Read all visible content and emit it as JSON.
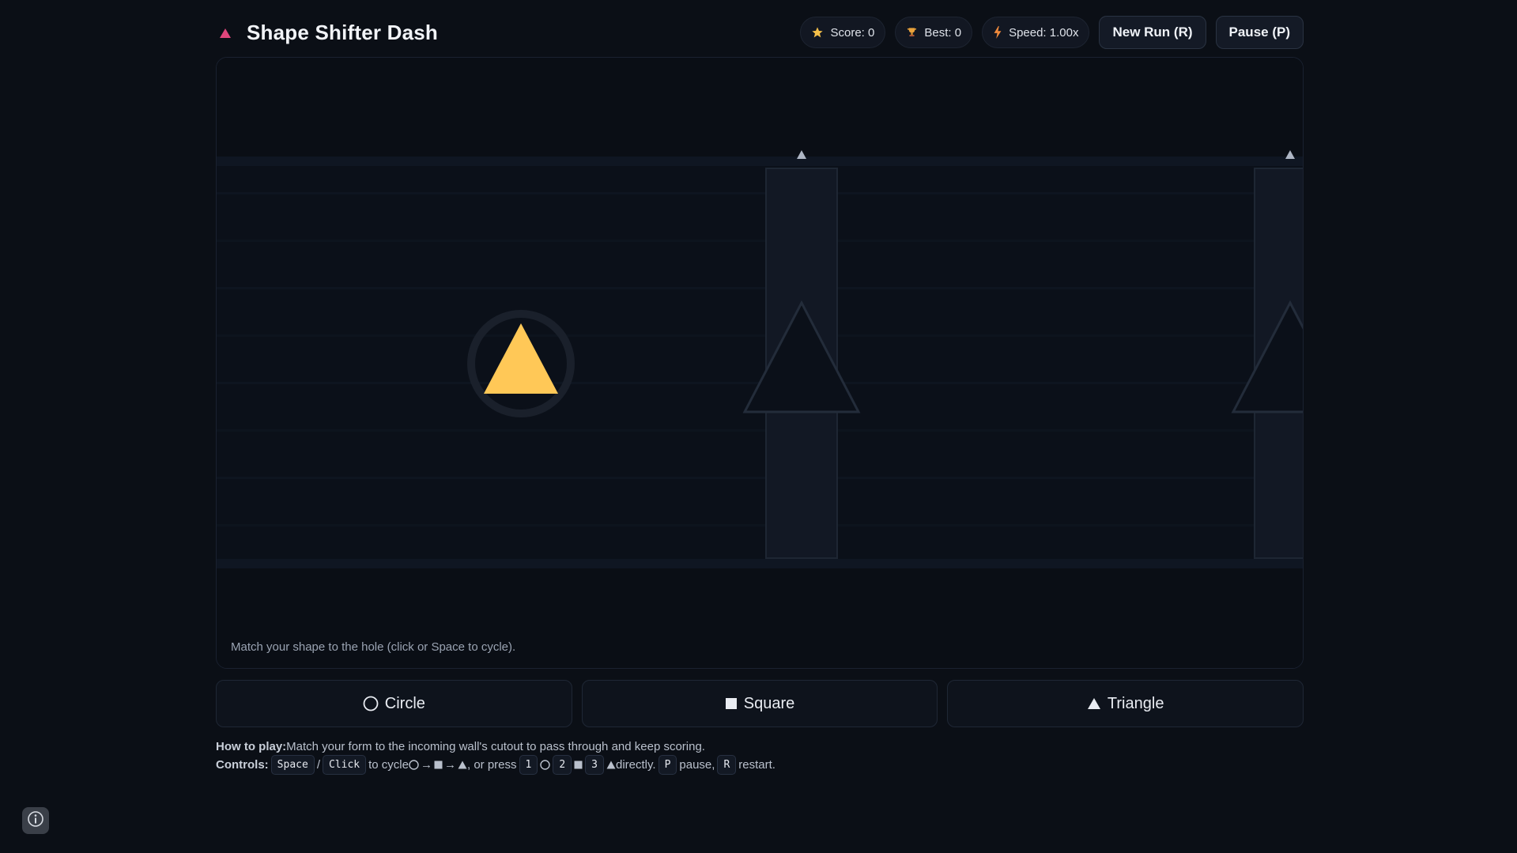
{
  "app": {
    "title": "Shape Shifter Dash",
    "accent": "#e0457b"
  },
  "hud": {
    "score": "Score: 0",
    "best": "Best: 0",
    "speed": "Speed: 1.00x",
    "new_run": "New Run (R)",
    "pause": "Pause (P)"
  },
  "game": {
    "hint": "Match your shape to the hole (click or Space to cycle).",
    "player_shape": "triangle",
    "player_color": "#ffc857",
    "walls": [
      {
        "cutout": "triangle"
      },
      {
        "cutout": "triangle"
      }
    ]
  },
  "choices": [
    {
      "label": "Circle",
      "icon": "circle-outline-icon"
    },
    {
      "label": "Square",
      "icon": "square-icon"
    },
    {
      "label": "Triangle",
      "icon": "triangle-icon"
    }
  ],
  "help": {
    "how_label": "How to play:",
    "how_text": "Match your form to the incoming wall's cutout to pass through and keep scoring.",
    "controls_label": "Controls:",
    "key_space": "Space",
    "sep": "/",
    "key_click": "Click",
    "cycle_text": "to cycle",
    "or_press": ", or press",
    "key_1": "1",
    "key_2": "2",
    "key_3": "3",
    "directly": "directly.",
    "key_p": "P",
    "pause_text": "pause,",
    "key_r": "R",
    "restart_text": "restart."
  }
}
